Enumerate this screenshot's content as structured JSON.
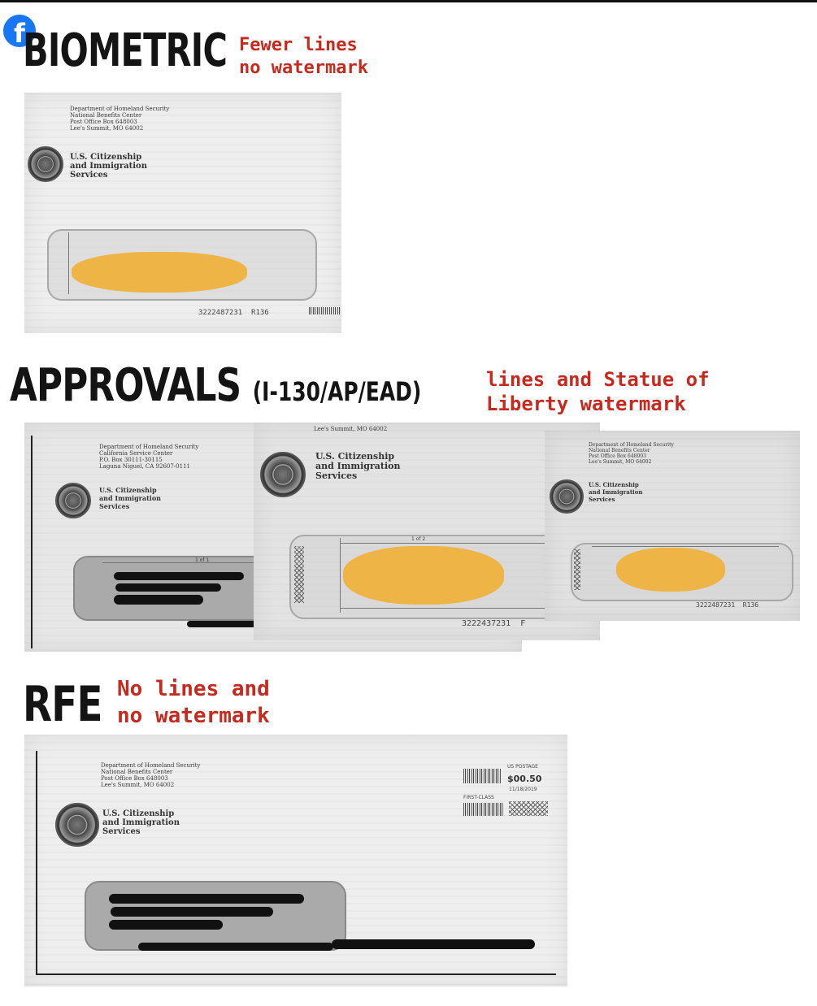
{
  "sections": {
    "biometric": {
      "title": "BIOMETRIC",
      "note": "Fewer lines\nno watermark",
      "envelope": {
        "return_address": "Department of Homeland Security\nNational Benefits Center\nPost Office Box 648003\nLee's Summit, MO 64002",
        "agency": "U.S. Citizenship\nand Immigration\nServices",
        "serial": "3222487231  R136"
      }
    },
    "approvals": {
      "title": "APPROVALS",
      "subtitle": "(I-130/AP/EAD)",
      "note": "lines and Statue of\nLiberty watermark",
      "envelopes": [
        {
          "return_address": "Department of Homeland Security\nCalifornia Service Center\nP.O. Box 30111-30115\nLaguna Niguel, CA 92607-0111",
          "agency": "U.S. Citizenship\nand Immigration\nServices",
          "page_marker": "1 of 1"
        },
        {
          "return_address": "Lee's Summit, MO 64002",
          "agency": "U.S. Citizenship\nand Immigration\nServices",
          "page_marker": "1 of 2",
          "serial": "3222437231  F"
        },
        {
          "return_address": "Department of Homeland Security\nNational Benefits Center\nPost Office Box 648003\nLee's Summit, MO 64002",
          "agency": "U.S. Citizenship\nand Immigration\nServices",
          "serial": "3222487231  R136"
        }
      ]
    },
    "rfe": {
      "title": "RFE",
      "note": "No lines and\nno watermark",
      "envelope": {
        "return_address": "Department of Homeland Security\nNational Benefits Center\nPost Office Box 648003\nLee's Summit, MO 64002",
        "agency": "U.S. Citizenship\nand Immigration\nServices",
        "postage_label": "US POSTAGE",
        "postage_amount": "$00.50",
        "postage_date": "11/18/2019",
        "postage_class": "FIRST-CLASS"
      }
    }
  },
  "colors": {
    "note": "#c62a1e",
    "heading": "#141414",
    "redaction": "#efb446",
    "facebook": "#1877f2"
  },
  "icons": {
    "badge": "facebook-icon",
    "seal": "dhs-seal-icon"
  }
}
